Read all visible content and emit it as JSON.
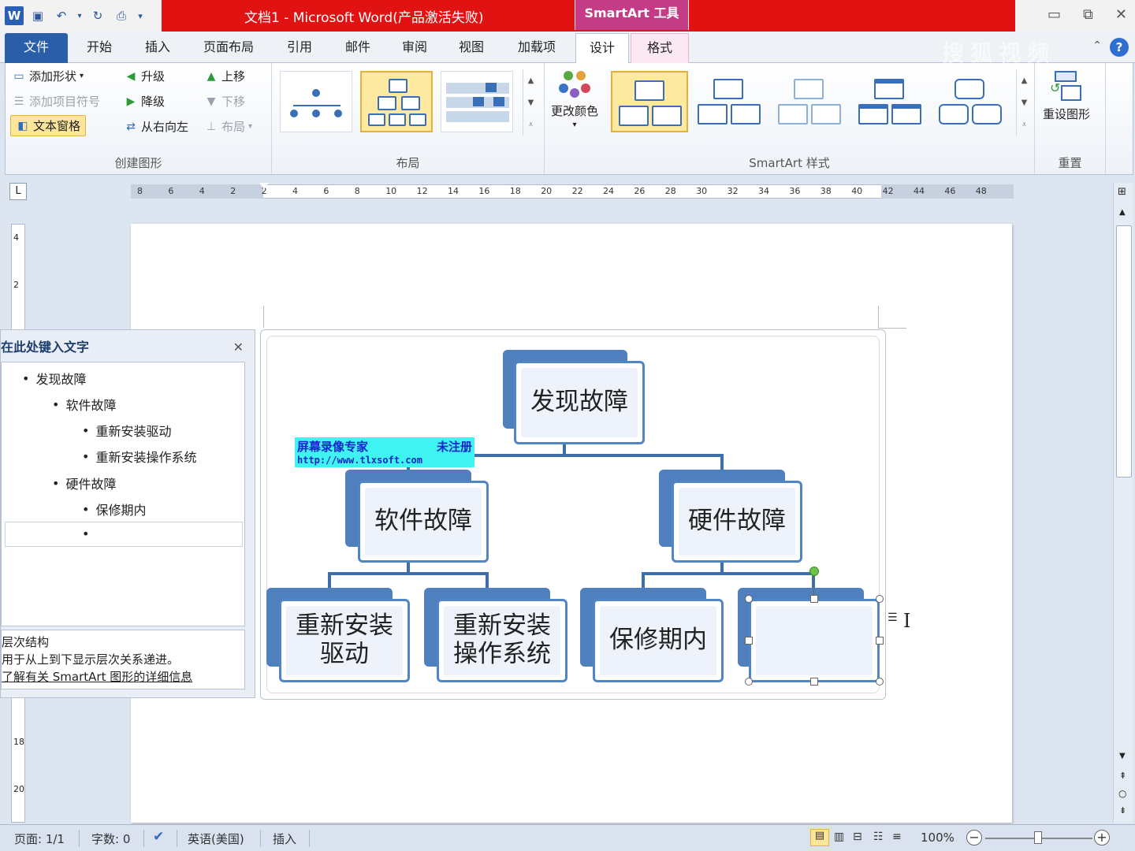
{
  "titlebar": {
    "doc_title": "文档1 - Microsoft Word(产品激活失败)",
    "contextual_tools": "SmartArt 工具",
    "word_logo": "W"
  },
  "tabs": {
    "file": "文件",
    "home": "开始",
    "insert": "插入",
    "page_layout": "页面布局",
    "references": "引用",
    "mailings": "邮件",
    "review": "审阅",
    "view": "视图",
    "addins": "加载项",
    "design": "设计",
    "format": "格式",
    "watermark": "搜狐视频"
  },
  "ribbon": {
    "create_graphic": {
      "label": "创建图形",
      "add_shape": "添加形状",
      "add_bullet": "添加项目符号",
      "text_pane": "文本窗格",
      "promote": "升级",
      "demote": "降级",
      "right_to_left": "从右向左",
      "move_up": "上移",
      "move_down": "下移",
      "layout": "布局"
    },
    "layouts": {
      "label": "布局"
    },
    "smartart_styles": {
      "label": "SmartArt 样式",
      "change_colors": "更改颜色"
    },
    "reset": {
      "label": "重置",
      "reset_graphic": "重设图形"
    }
  },
  "ruler": {
    "ticks": [
      "8",
      "6",
      "4",
      "2",
      "2",
      "4",
      "6",
      "8",
      "10",
      "12",
      "14",
      "16",
      "18",
      "20",
      "22",
      "24",
      "26",
      "28",
      "30",
      "32",
      "34",
      "36",
      "38",
      "40",
      "42",
      "44",
      "46",
      "48"
    ],
    "vticks": [
      "4",
      "2",
      "18",
      "20"
    ]
  },
  "smartart": {
    "top": "发现故障",
    "software": "软件故障",
    "hardware": "硬件故障",
    "reinstall_driver_1": "重新安装",
    "reinstall_driver_2": "驱动",
    "reinstall_os_1": "重新安装",
    "reinstall_os_2": "操作系统",
    "warranty": "保修期内",
    "empty": ""
  },
  "watermark": {
    "line1a": "屏幕录像专家",
    "line1b": "未注册",
    "line2": "http://www.tlxsoft.com"
  },
  "text_pane": {
    "title": "在此处键入文字",
    "items": [
      {
        "level": 1,
        "text": "发现故障"
      },
      {
        "level": 2,
        "text": "软件故障"
      },
      {
        "level": 3,
        "text": "重新安装驱动"
      },
      {
        "level": 3,
        "text": "重新安装操作系统"
      },
      {
        "level": 2,
        "text": "硬件故障"
      },
      {
        "level": 3,
        "text": "保修期内"
      },
      {
        "level": 3,
        "text": ""
      }
    ],
    "desc_title": "层次结构",
    "desc_body": "用于从上到下显示层次关系递进。",
    "desc_link": "了解有关 SmartArt 图形的详细信息"
  },
  "statusbar": {
    "page": "页面: 1/1",
    "words": "字数: 0",
    "language": "英语(美国)",
    "mode": "插入",
    "zoom": "100%"
  },
  "colors": {
    "title_red": "#e01212",
    "contextual_pink": "#c43c86",
    "file_tab": "#2a5ea9",
    "shape_blue": "#4f7fbd",
    "selection_yellow": "#fde9a0"
  }
}
